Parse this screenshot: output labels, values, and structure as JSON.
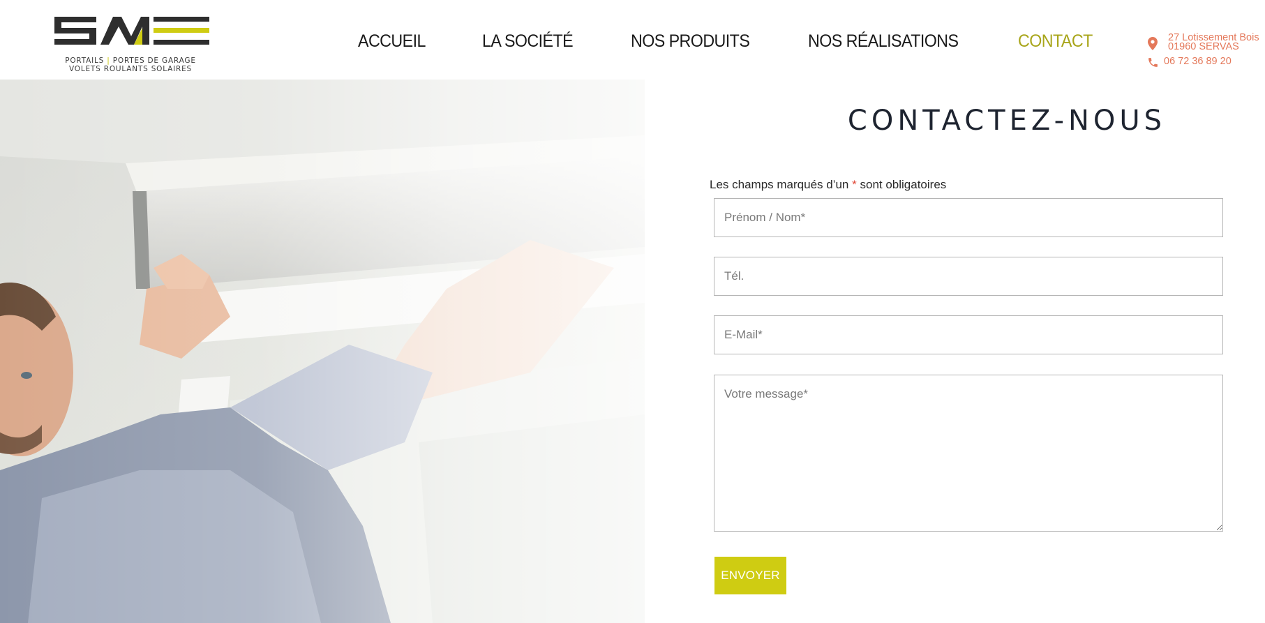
{
  "brand": {
    "logo_text": "SME",
    "tagline_line1_a": "PORTAILS",
    "tagline_line1_sep": "|",
    "tagline_line1_b": "PORTES DE GARAGE",
    "tagline_line2": "VOLETS ROULANTS SOLAIRES",
    "accent_color": "#cfcc12"
  },
  "nav": {
    "items": [
      {
        "label": "ACCUEIL"
      },
      {
        "label": "LA SOCIÉTÉ"
      },
      {
        "label": "NOS PRODUITS"
      },
      {
        "label": "NOS RÉALISATIONS"
      },
      {
        "label": "CONTACT",
        "active": true
      }
    ],
    "active_color": "#a8a51a"
  },
  "contact_info": {
    "address_line1": "27 Lotissement Bois",
    "address_line2": "01960 SERVAS",
    "phone": "06 72 36 89 20",
    "address_icon": "map-pin-icon",
    "phone_icon": "phone-icon",
    "color": "#e4785a"
  },
  "form": {
    "title": "CONTACTEZ-NOUS",
    "note_prefix": "Les champs marqués d’un",
    "note_star": "*",
    "note_suffix": "sont obligatoires",
    "name_placeholder": "Prénom / Nom*",
    "tel_placeholder": "Tél.",
    "email_placeholder": "E-Mail*",
    "message_placeholder": "Votre message*",
    "submit_label": "ENVOYER",
    "submit_color": "#cfcc12"
  }
}
